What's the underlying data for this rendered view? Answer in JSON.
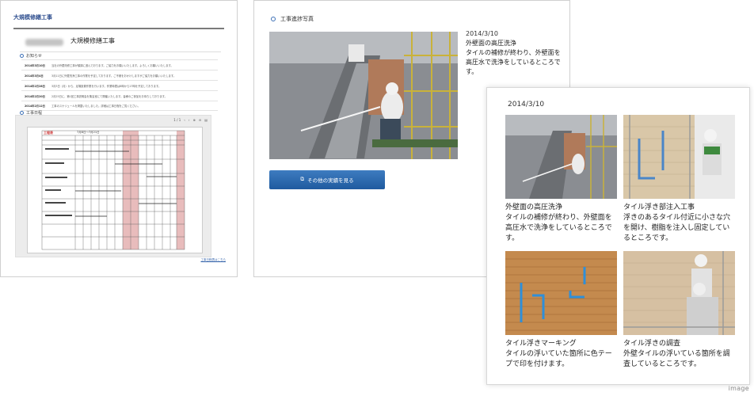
{
  "panel1": {
    "header": "大規模修繕工事",
    "page_title": "大規模修繕工事",
    "news_heading": "お知らせ",
    "news": [
      {
        "date": "2014年3月10日",
        "text": "当社の外壁改修工事が順調に進んでおります。ご協力をお願いいたします。よろしくお願いいたします。"
      },
      {
        "date": "2014年3月4日",
        "text": "3月11日に外壁洗浄工事の作業を予定しております。ご不便をおかけしますがご協力をお願いいたします。"
      },
      {
        "date": "2014年2月28日",
        "text": "3月3日（月）から、足場設置作業を行います。作業時間は8時から17時を予定しております。"
      },
      {
        "date": "2014年2月20日",
        "text": "2月25日に、第1回工事説明会を集会室にて開催いたします。皆様のご参加をお待ちしております。"
      },
      {
        "date": "2014年2月12日",
        "text": "工事のスケジュールを掲載いたしました。詳細は工事日程をご覧ください。"
      }
    ],
    "schedule_heading": "工事日程",
    "schedule_pager": "1 / 1",
    "schedule_sheet_title": "工程表",
    "schedule_sheet_period": "7月8日〜7月21日",
    "footer_link": "工事日程表はこちら"
  },
  "panel2": {
    "heading": "工事進捗写真",
    "date": "2014/3/10",
    "caption_title": "外壁面の高圧洗浄",
    "caption_text": "タイルの補修が終わり、外壁面を高圧水で洗浄をしているところです。",
    "button_label": "その他の実績を見る"
  },
  "panel3": {
    "date": "2014/3/10",
    "items": [
      {
        "title": "外壁面の高圧洗浄",
        "caption": "タイルの補修が終わり、外壁面を高圧水で洗浄をしているところです。"
      },
      {
        "title": "タイル浮き部注入工事",
        "caption": "浮きのあるタイル付近に小さな穴を開け、樹脂を注入し固定しているところです。"
      },
      {
        "title": "タイル浮きマーキング",
        "caption": "タイルの浮いていた箇所に色テープで印を付けます。"
      },
      {
        "title": "タイル浮きの調査",
        "caption": "外壁タイルの浮いている箇所を調査しているところです。"
      }
    ]
  },
  "watermark": "image",
  "colors": {
    "accent_blue": "#2f5fa8",
    "button_top": "#3e7cc0",
    "button_bottom": "#1f5a9f",
    "schedule_pink": "#e8bcbc"
  },
  "icons": {
    "heading": "ring-icon",
    "button": "external-link-icon",
    "zoom_in": "zoom-in-icon",
    "zoom_out": "zoom-out-icon",
    "print": "print-icon"
  }
}
